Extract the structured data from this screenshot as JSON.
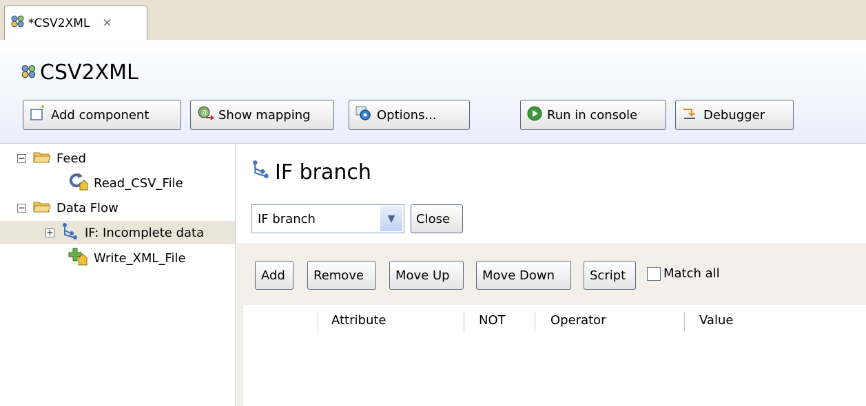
{
  "tab": {
    "label": "*CSV2XML"
  },
  "header": {
    "title": "CSV2XML",
    "buttons": {
      "add_component": "Add component",
      "show_mapping": "Show mapping",
      "options": "Options...",
      "run_console": "Run in console",
      "debugger": "Debugger"
    }
  },
  "tree": {
    "feed": "Feed",
    "read_csv": "Read_CSV_File",
    "data_flow": "Data Flow",
    "if_node": "IF: Incomplete data",
    "write_xml": "Write_XML_File"
  },
  "panel": {
    "title": "IF branch",
    "select_value": "IF branch",
    "close": "Close",
    "add": "Add",
    "remove": "Remove",
    "move_up": "Move Up",
    "move_down": "Move Down",
    "script": "Script",
    "match_all": "Match all",
    "columns": [
      "Attribute",
      "NOT",
      "Operator",
      "Value"
    ]
  },
  "colors": {
    "accent": "#3a9a3a",
    "folder": "#f0c35a",
    "tab_strip": "#e9e2d3"
  }
}
